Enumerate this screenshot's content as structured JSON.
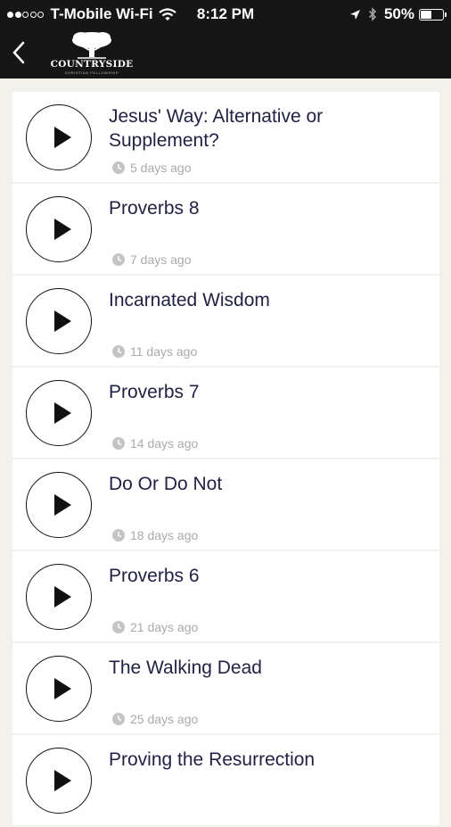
{
  "status_bar": {
    "carrier": "T-Mobile Wi-Fi",
    "time": "8:12 PM",
    "battery_percent": "50%",
    "signal_bars_filled": 2,
    "signal_bars_total": 5,
    "battery_level": 0.5
  },
  "header": {
    "logo_name": "COUNTRYSIDE",
    "logo_subtitle": "CHRISTIAN FELLOWSHIP",
    "background": "#161616"
  },
  "sermons": [
    {
      "title": "Jesus' Way: Alternative or Supplement?",
      "age": "5 days ago"
    },
    {
      "title": "Proverbs 8",
      "age": "7 days ago"
    },
    {
      "title": "Incarnated Wisdom",
      "age": "11 days ago"
    },
    {
      "title": "Proverbs 7",
      "age": "14 days ago"
    },
    {
      "title": "Do Or Do Not",
      "age": "18 days ago"
    },
    {
      "title": "Proverbs 6",
      "age": "21 days ago"
    },
    {
      "title": "The Walking Dead",
      "age": "25 days ago"
    },
    {
      "title": "Proving the Resurrection",
      "age": ""
    }
  ]
}
